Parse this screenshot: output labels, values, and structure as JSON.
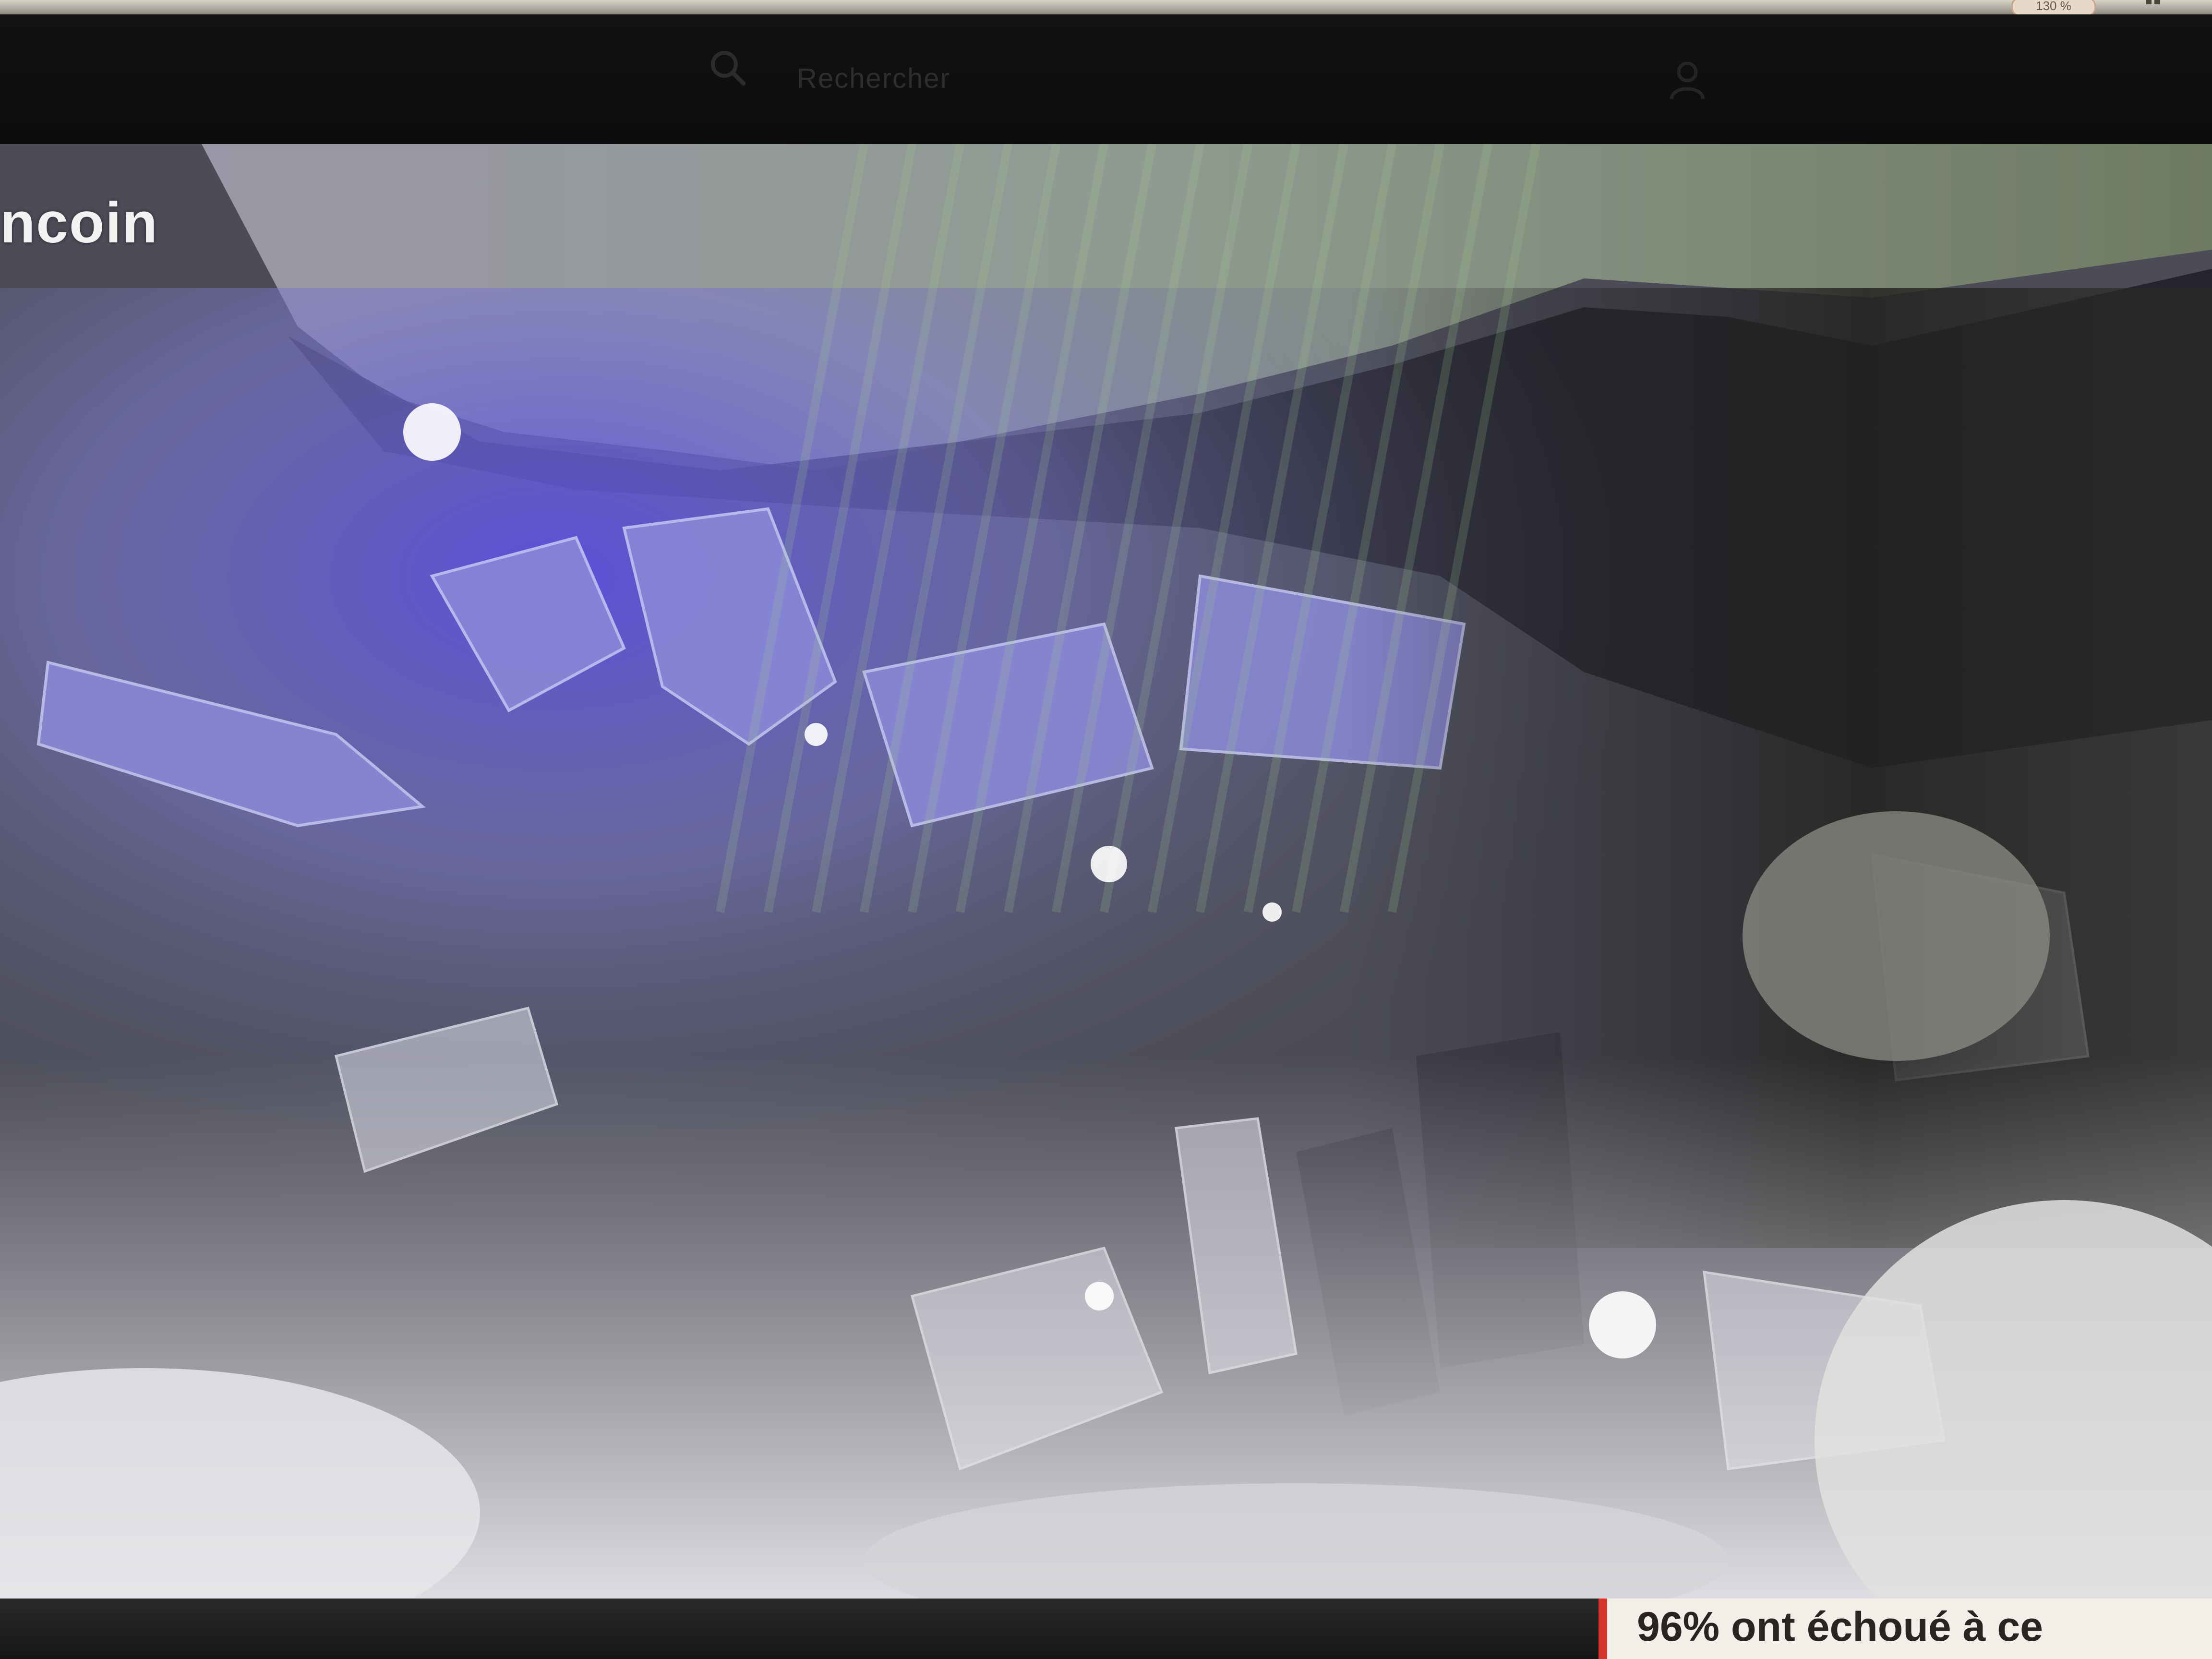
{
  "browser": {
    "zoom_label": "130 %",
    "tool_icon": "grid-icon"
  },
  "header": {
    "search_icon": "search-icon",
    "search_placeholder": "Rechercher",
    "user_icon": "user-icon"
  },
  "hero": {
    "brand_label": "ncoin",
    "image_description_icon": "crystal-photo"
  },
  "ad": {
    "headline": "96% ont échoué à ce"
  },
  "colors": {
    "header_bg": "#0e0e10",
    "ad_accent": "#d7342b",
    "crystal_violet": "#6f62d6",
    "crystal_grey": "#c9c8ce"
  }
}
